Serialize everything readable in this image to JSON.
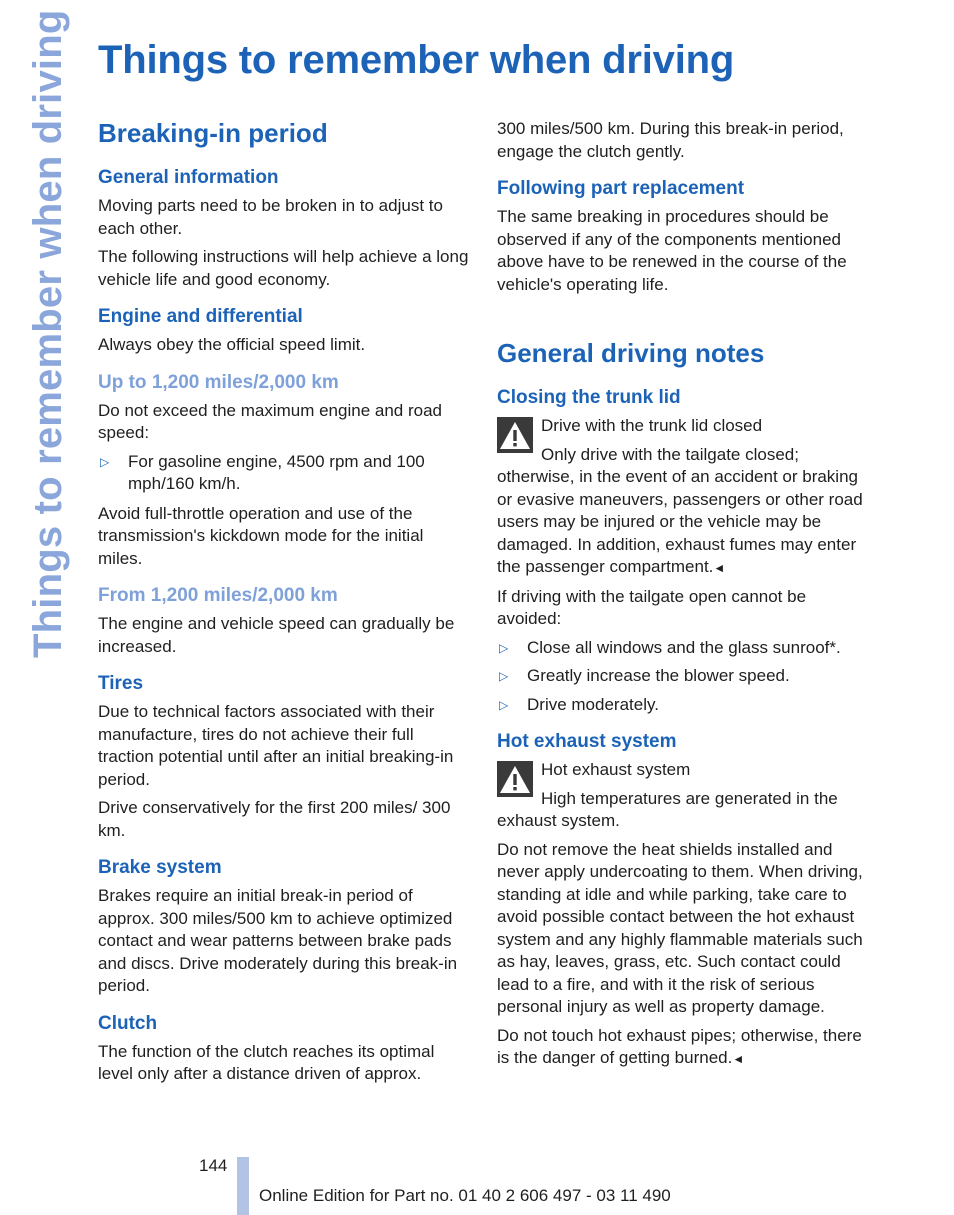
{
  "side_tab": "Things to remember when driving",
  "page_title": "Things to remember when driving",
  "left_column": {
    "section_title": "Breaking-in period",
    "general_information": {
      "heading": "General information",
      "paragraphs": [
        "Moving parts need to be broken in to adjust to each other.",
        "The following instructions will help achieve a long vehicle life and good economy."
      ]
    },
    "engine": {
      "heading": "Engine and differential",
      "paragraph": "Always obey the official speed limit."
    },
    "up_to": {
      "heading": "Up to 1,200 miles/2,000 km",
      "paragraph": "Do not exceed the maximum engine and road speed:",
      "bullet": "For gasoline engine, 4500 rpm and 100 mph/160 km/h.",
      "paragraph2": "Avoid full-throttle operation and use of the transmission's kickdown mode for the initial miles."
    },
    "from": {
      "heading": "From 1,200 miles/2,000 km",
      "paragraph": "The engine and vehicle speed can gradually be increased."
    },
    "tires": {
      "heading": "Tires",
      "paragraphs": [
        "Due to technical factors associated with their manufacture, tires do not achieve their full traction potential until after an initial breaking-in period.",
        "Drive conservatively for the first 200 miles/ 300 km."
      ]
    },
    "brake": {
      "heading": "Brake system",
      "paragraph": "Brakes require an initial break-in period of approx. 300 miles/500 km to achieve optimized contact and wear patterns between brake pads and discs. Drive moderately during this break-in period."
    },
    "clutch": {
      "heading": "Clutch",
      "paragraph": "The function of the clutch reaches its optimal level only after a distance driven of approx."
    }
  },
  "right_column": {
    "clutch_continued": "300 miles/500 km. During this break-in period, engage the clutch gently.",
    "part_replacement": {
      "heading": "Following part replacement",
      "paragraph": "The same breaking in procedures should be observed if any of the components mentioned above have to be renewed in the course of the vehicle's operating life."
    },
    "section_title": "General driving notes",
    "trunk": {
      "heading": "Closing the trunk lid",
      "warning_title": "Drive with the trunk lid closed",
      "warning_text": "Only drive with the tailgate closed; otherwise, in the event of an accident or braking or evasive maneuvers, passengers or other road users may be injured or the vehicle may be damaged. In addition, exhaust fumes may enter the passenger compartment.",
      "paragraph": "If driving with the tailgate open cannot be avoided:",
      "bullets": [
        "Close all windows and the glass sunroof*.",
        "Greatly increase the blower speed.",
        "Drive moderately."
      ]
    },
    "exhaust": {
      "heading": "Hot exhaust system",
      "warning_title": "Hot exhaust system",
      "warning_text": "High temperatures are generated in the exhaust system.",
      "paragraphs": [
        "Do not remove the heat shields installed and never apply undercoating to them. When driving, standing at idle and while parking, take care to avoid possible contact between the hot exhaust system and any highly flammable materials such as hay, leaves, grass, etc. Such contact could lead to a fire, and with it the risk of serious personal injury as well as property damage."
      ],
      "final_paragraph": "Do not touch hot exhaust pipes; otherwise, there is the danger of getting burned."
    }
  },
  "end_mark": "◄",
  "bullet_glyph": "▷",
  "footer": {
    "page_number": "144",
    "edition": "Online Edition for Part no. 01 40 2 606 497 - 03 11 490"
  }
}
